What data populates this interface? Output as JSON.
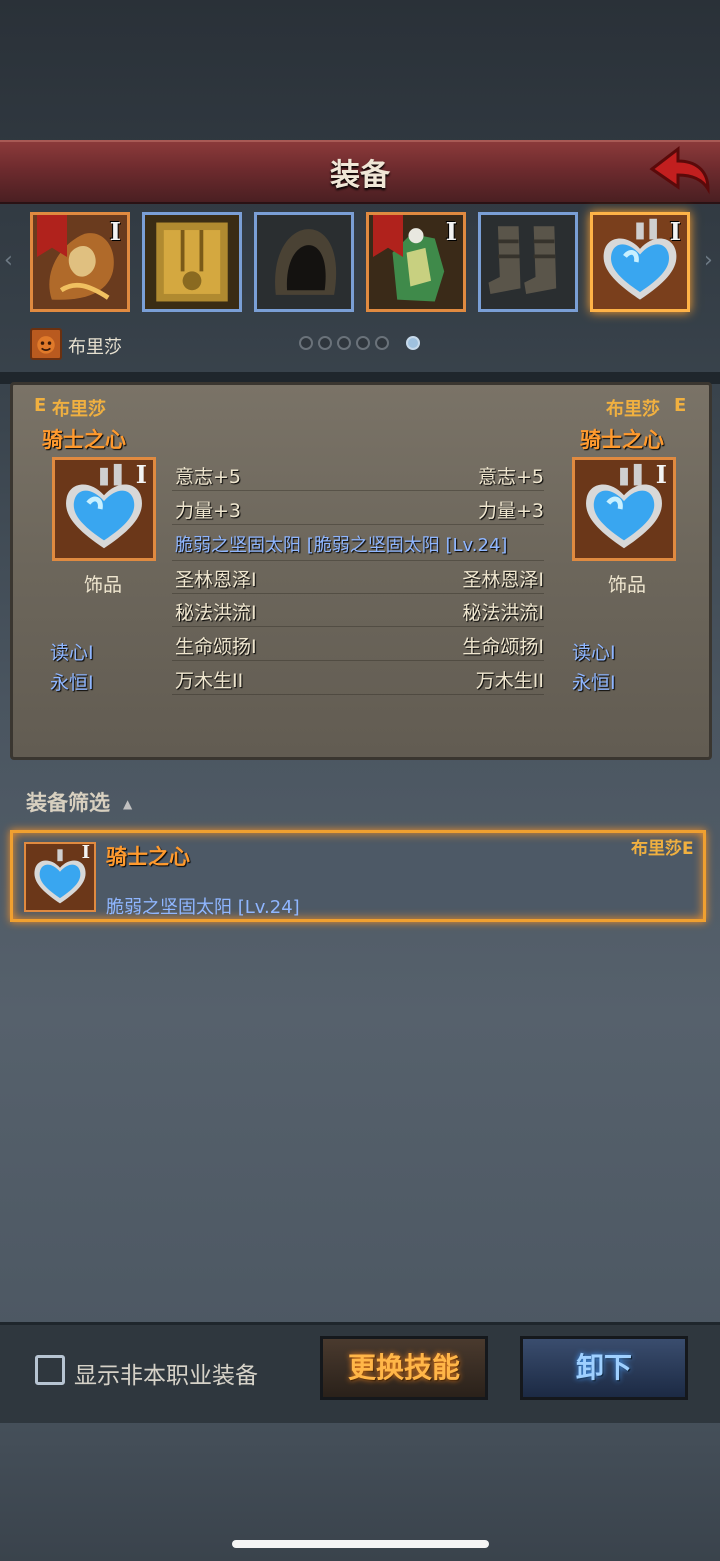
{
  "header": {
    "title": "装备"
  },
  "slots": [
    {
      "name": "cloak",
      "tier": "I"
    },
    {
      "name": "armor"
    },
    {
      "name": "hood"
    },
    {
      "name": "gloves",
      "tier": "I"
    },
    {
      "name": "boots"
    },
    {
      "name": "heart-necklace",
      "tier": "I"
    }
  ],
  "character": {
    "name": "布里莎"
  },
  "pager": {
    "total": 6,
    "active": 6
  },
  "compare": {
    "left": {
      "grade": "E",
      "owner": "布里莎",
      "item_name": "骑士之心",
      "item_tier": "I",
      "category": "饰品",
      "extra_skills": [
        "读心I",
        "永恒I"
      ]
    },
    "right": {
      "grade": "E",
      "owner": "布里莎",
      "item_name": "骑士之心",
      "item_tier": "I",
      "category": "饰品",
      "extra_skills": [
        "读心I",
        "永恒I"
      ]
    },
    "stats_left": [
      "意志+5",
      "力量+3"
    ],
    "stats_right": [
      "意志+5",
      "力量+3"
    ],
    "rune_line": "脆弱之坚固太阳 [脆弱之坚固太阳 [Lv.24]",
    "skills_left": [
      "圣林恩泽I",
      "秘法洪流I",
      "生命颂扬I",
      "万木生II"
    ],
    "skills_right": [
      "圣林恩泽I",
      "秘法洪流I",
      "生命颂扬I",
      "万木生II"
    ]
  },
  "filter": {
    "label": "装备筛选"
  },
  "list": [
    {
      "name": "骑士之心",
      "tier": "I",
      "owner": "布里莎E",
      "rune": "脆弱之坚固太阳 [Lv.24]"
    }
  ],
  "footer": {
    "checkbox_label": "显示非本职业装备",
    "skill_button": "更换技能",
    "unequip_button": "卸下"
  },
  "colors": {
    "accent_orange": "#f0a030",
    "title_red": "#6e2b2e",
    "blue_text": "#8fb6ff"
  }
}
